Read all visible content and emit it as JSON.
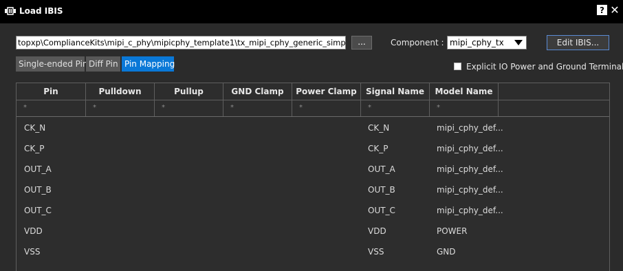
{
  "window": {
    "title": "Load IBIS",
    "help_label": "?",
    "close_label": "✕",
    "icon": "app-icon"
  },
  "path": {
    "value": "topxp\\ComplianceKits\\mipi_c_phy\\mipicphy_template1\\tx_mipi_cphy_generic_simple.ibs"
  },
  "browse": {
    "label": "..."
  },
  "component": {
    "label": "Component :",
    "value": "mipi_cphy_tx"
  },
  "edit_button": {
    "label": "Edit IBIS..."
  },
  "tabs": [
    {
      "label": "Single-ended Pin",
      "active": false
    },
    {
      "label": "Diff Pin",
      "active": false
    },
    {
      "label": "Pin Mapping",
      "active": true
    }
  ],
  "explicit_io": {
    "label": "Explicit IO Power and Ground Terminals",
    "checked": false
  },
  "table": {
    "columns": [
      "Pin",
      "Pulldown",
      "Pullup",
      "GND Clamp",
      "Power Clamp",
      "Signal Name",
      "Model Name"
    ],
    "filter_placeholder": "*",
    "rows": [
      {
        "pin": "CK_N",
        "signal": "CK_N",
        "model": "mipi_cphy_def..."
      },
      {
        "pin": "CK_P",
        "signal": "CK_P",
        "model": "mipi_cphy_def..."
      },
      {
        "pin": "OUT_A",
        "signal": "OUT_A",
        "model": "mipi_cphy_def..."
      },
      {
        "pin": "OUT_B",
        "signal": "OUT_B",
        "model": "mipi_cphy_def..."
      },
      {
        "pin": "OUT_C",
        "signal": "OUT_C",
        "model": "mipi_cphy_def..."
      },
      {
        "pin": "VDD",
        "signal": "VDD",
        "model": "POWER"
      },
      {
        "pin": "VSS",
        "signal": "VSS",
        "model": "GND"
      }
    ]
  }
}
